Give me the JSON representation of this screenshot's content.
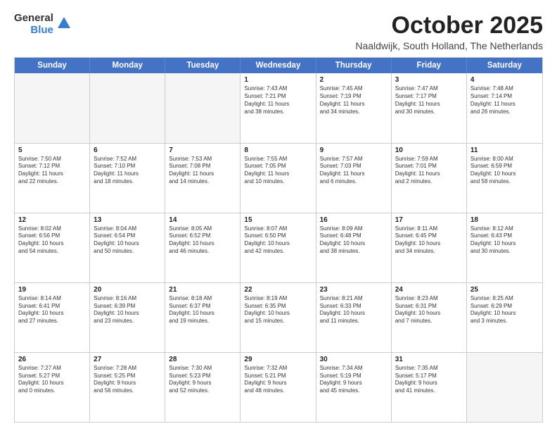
{
  "logo": {
    "general": "General",
    "blue": "Blue"
  },
  "header": {
    "month": "October 2025",
    "location": "Naaldwijk, South Holland, The Netherlands"
  },
  "weekdays": [
    "Sunday",
    "Monday",
    "Tuesday",
    "Wednesday",
    "Thursday",
    "Friday",
    "Saturday"
  ],
  "rows": [
    [
      {
        "day": "",
        "empty": true
      },
      {
        "day": "",
        "empty": true
      },
      {
        "day": "",
        "empty": true
      },
      {
        "day": "1",
        "line1": "Sunrise: 7:43 AM",
        "line2": "Sunset: 7:21 PM",
        "line3": "Daylight: 11 hours",
        "line4": "and 38 minutes."
      },
      {
        "day": "2",
        "line1": "Sunrise: 7:45 AM",
        "line2": "Sunset: 7:19 PM",
        "line3": "Daylight: 11 hours",
        "line4": "and 34 minutes."
      },
      {
        "day": "3",
        "line1": "Sunrise: 7:47 AM",
        "line2": "Sunset: 7:17 PM",
        "line3": "Daylight: 11 hours",
        "line4": "and 30 minutes."
      },
      {
        "day": "4",
        "line1": "Sunrise: 7:48 AM",
        "line2": "Sunset: 7:14 PM",
        "line3": "Daylight: 11 hours",
        "line4": "and 26 minutes."
      }
    ],
    [
      {
        "day": "5",
        "line1": "Sunrise: 7:50 AM",
        "line2": "Sunset: 7:12 PM",
        "line3": "Daylight: 11 hours",
        "line4": "and 22 minutes."
      },
      {
        "day": "6",
        "line1": "Sunrise: 7:52 AM",
        "line2": "Sunset: 7:10 PM",
        "line3": "Daylight: 11 hours",
        "line4": "and 18 minutes."
      },
      {
        "day": "7",
        "line1": "Sunrise: 7:53 AM",
        "line2": "Sunset: 7:08 PM",
        "line3": "Daylight: 11 hours",
        "line4": "and 14 minutes."
      },
      {
        "day": "8",
        "line1": "Sunrise: 7:55 AM",
        "line2": "Sunset: 7:05 PM",
        "line3": "Daylight: 11 hours",
        "line4": "and 10 minutes."
      },
      {
        "day": "9",
        "line1": "Sunrise: 7:57 AM",
        "line2": "Sunset: 7:03 PM",
        "line3": "Daylight: 11 hours",
        "line4": "and 6 minutes."
      },
      {
        "day": "10",
        "line1": "Sunrise: 7:59 AM",
        "line2": "Sunset: 7:01 PM",
        "line3": "Daylight: 11 hours",
        "line4": "and 2 minutes."
      },
      {
        "day": "11",
        "line1": "Sunrise: 8:00 AM",
        "line2": "Sunset: 6:59 PM",
        "line3": "Daylight: 10 hours",
        "line4": "and 58 minutes."
      }
    ],
    [
      {
        "day": "12",
        "line1": "Sunrise: 8:02 AM",
        "line2": "Sunset: 6:56 PM",
        "line3": "Daylight: 10 hours",
        "line4": "and 54 minutes."
      },
      {
        "day": "13",
        "line1": "Sunrise: 8:04 AM",
        "line2": "Sunset: 6:54 PM",
        "line3": "Daylight: 10 hours",
        "line4": "and 50 minutes."
      },
      {
        "day": "14",
        "line1": "Sunrise: 8:05 AM",
        "line2": "Sunset: 6:52 PM",
        "line3": "Daylight: 10 hours",
        "line4": "and 46 minutes."
      },
      {
        "day": "15",
        "line1": "Sunrise: 8:07 AM",
        "line2": "Sunset: 6:50 PM",
        "line3": "Daylight: 10 hours",
        "line4": "and 42 minutes."
      },
      {
        "day": "16",
        "line1": "Sunrise: 8:09 AM",
        "line2": "Sunset: 6:48 PM",
        "line3": "Daylight: 10 hours",
        "line4": "and 38 minutes."
      },
      {
        "day": "17",
        "line1": "Sunrise: 8:11 AM",
        "line2": "Sunset: 6:45 PM",
        "line3": "Daylight: 10 hours",
        "line4": "and 34 minutes."
      },
      {
        "day": "18",
        "line1": "Sunrise: 8:12 AM",
        "line2": "Sunset: 6:43 PM",
        "line3": "Daylight: 10 hours",
        "line4": "and 30 minutes."
      }
    ],
    [
      {
        "day": "19",
        "line1": "Sunrise: 8:14 AM",
        "line2": "Sunset: 6:41 PM",
        "line3": "Daylight: 10 hours",
        "line4": "and 27 minutes."
      },
      {
        "day": "20",
        "line1": "Sunrise: 8:16 AM",
        "line2": "Sunset: 6:39 PM",
        "line3": "Daylight: 10 hours",
        "line4": "and 23 minutes."
      },
      {
        "day": "21",
        "line1": "Sunrise: 8:18 AM",
        "line2": "Sunset: 6:37 PM",
        "line3": "Daylight: 10 hours",
        "line4": "and 19 minutes."
      },
      {
        "day": "22",
        "line1": "Sunrise: 8:19 AM",
        "line2": "Sunset: 6:35 PM",
        "line3": "Daylight: 10 hours",
        "line4": "and 15 minutes."
      },
      {
        "day": "23",
        "line1": "Sunrise: 8:21 AM",
        "line2": "Sunset: 6:33 PM",
        "line3": "Daylight: 10 hours",
        "line4": "and 11 minutes."
      },
      {
        "day": "24",
        "line1": "Sunrise: 8:23 AM",
        "line2": "Sunset: 6:31 PM",
        "line3": "Daylight: 10 hours",
        "line4": "and 7 minutes."
      },
      {
        "day": "25",
        "line1": "Sunrise: 8:25 AM",
        "line2": "Sunset: 6:29 PM",
        "line3": "Daylight: 10 hours",
        "line4": "and 3 minutes."
      }
    ],
    [
      {
        "day": "26",
        "line1": "Sunrise: 7:27 AM",
        "line2": "Sunset: 5:27 PM",
        "line3": "Daylight: 10 hours",
        "line4": "and 0 minutes."
      },
      {
        "day": "27",
        "line1": "Sunrise: 7:28 AM",
        "line2": "Sunset: 5:25 PM",
        "line3": "Daylight: 9 hours",
        "line4": "and 56 minutes."
      },
      {
        "day": "28",
        "line1": "Sunrise: 7:30 AM",
        "line2": "Sunset: 5:23 PM",
        "line3": "Daylight: 9 hours",
        "line4": "and 52 minutes."
      },
      {
        "day": "29",
        "line1": "Sunrise: 7:32 AM",
        "line2": "Sunset: 5:21 PM",
        "line3": "Daylight: 9 hours",
        "line4": "and 48 minutes."
      },
      {
        "day": "30",
        "line1": "Sunrise: 7:34 AM",
        "line2": "Sunset: 5:19 PM",
        "line3": "Daylight: 9 hours",
        "line4": "and 45 minutes."
      },
      {
        "day": "31",
        "line1": "Sunrise: 7:35 AM",
        "line2": "Sunset: 5:17 PM",
        "line3": "Daylight: 9 hours",
        "line4": "and 41 minutes."
      },
      {
        "day": "",
        "empty": true
      }
    ]
  ]
}
